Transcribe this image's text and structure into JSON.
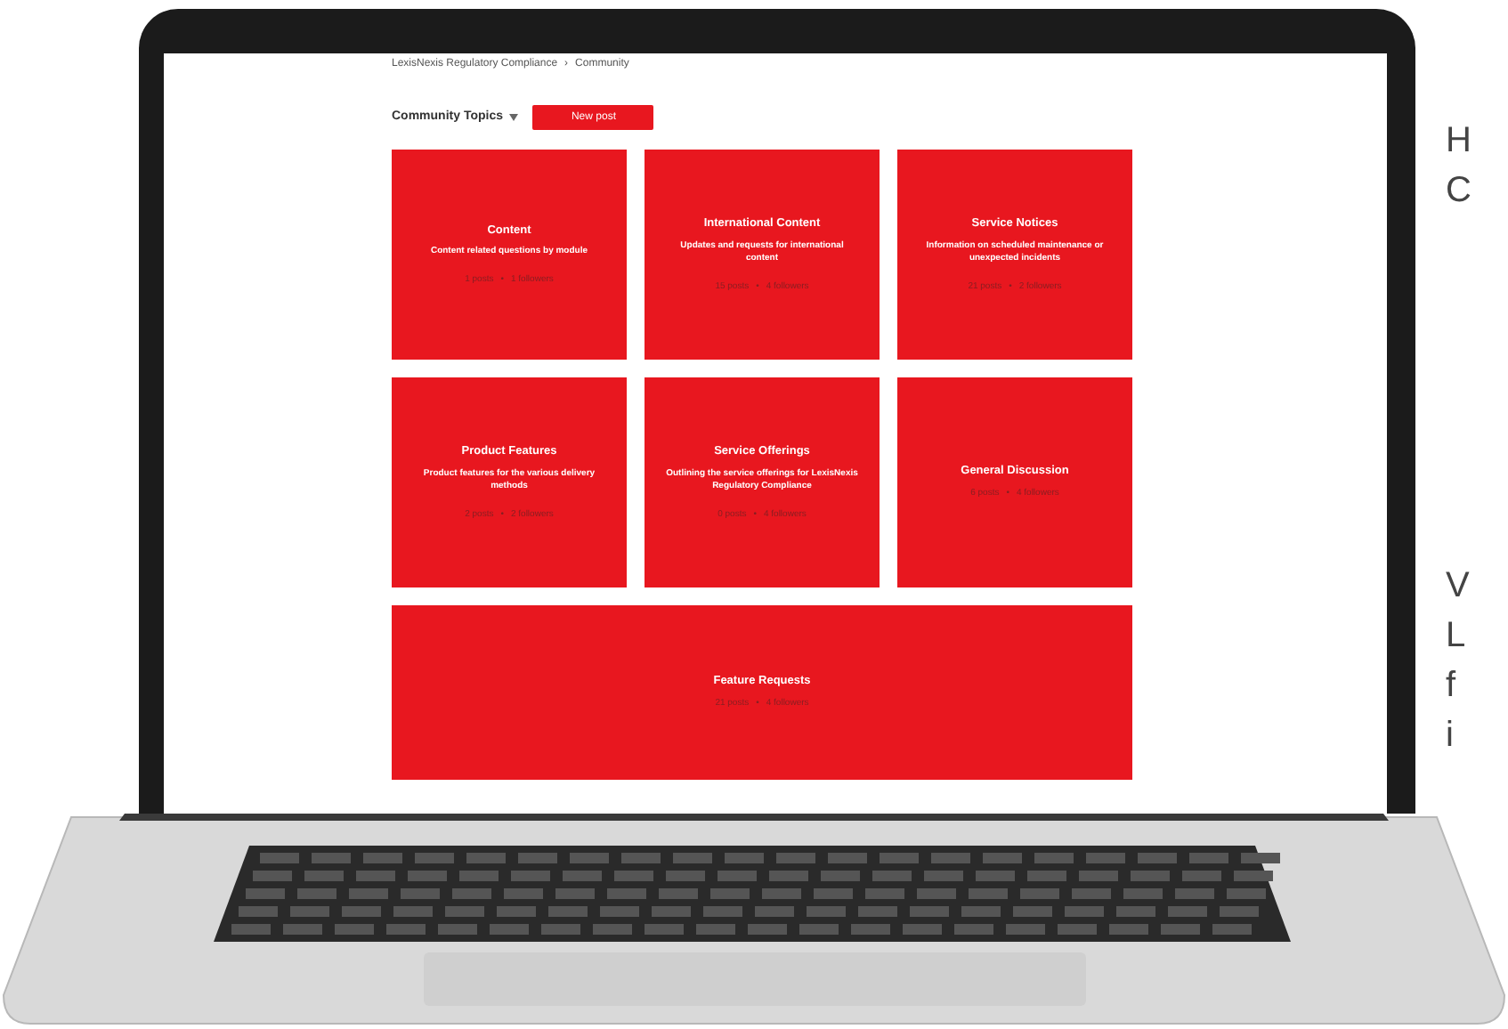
{
  "breadcrumb": {
    "items": [
      "LexisNexis Regulatory Compliance",
      "Community"
    ],
    "separator": "›"
  },
  "toolbar": {
    "title": "Community Topics",
    "button": "New post"
  },
  "topics": [
    {
      "kind": "tile",
      "title": "Content",
      "description": "Content related questions by module",
      "posts": "1 posts",
      "separator": "•",
      "followers": "1 followers"
    },
    {
      "kind": "tile",
      "title": "International Content",
      "description": "Updates and requests for international content",
      "posts": "15 posts",
      "separator": "•",
      "followers": "4 followers"
    },
    {
      "kind": "tile",
      "title": "Service Notices",
      "description": "Information on scheduled maintenance or unexpected incidents",
      "posts": "21 posts",
      "separator": "•",
      "followers": "2 followers"
    },
    {
      "kind": "tile",
      "title": "Product Features",
      "description": "Product features for the various delivery methods",
      "posts": "2 posts",
      "separator": "•",
      "followers": "2 followers"
    },
    {
      "kind": "tile",
      "title": "Service Offerings",
      "description": "Outlining the service offerings for LexisNexis Regulatory Compliance",
      "posts": "0 posts",
      "separator": "•",
      "followers": "4 followers"
    },
    {
      "kind": "tile",
      "title": "General Discussion",
      "posts": "6 posts",
      "separator": "•",
      "followers": "4 followers"
    },
    {
      "kind": "wide",
      "title": "Feature Requests",
      "posts": "21 posts",
      "separator": "•",
      "followers": "4 followers"
    }
  ],
  "side_text": [
    [
      "H",
      "C"
    ],
    [
      "V",
      "L",
      "f",
      "i"
    ]
  ]
}
